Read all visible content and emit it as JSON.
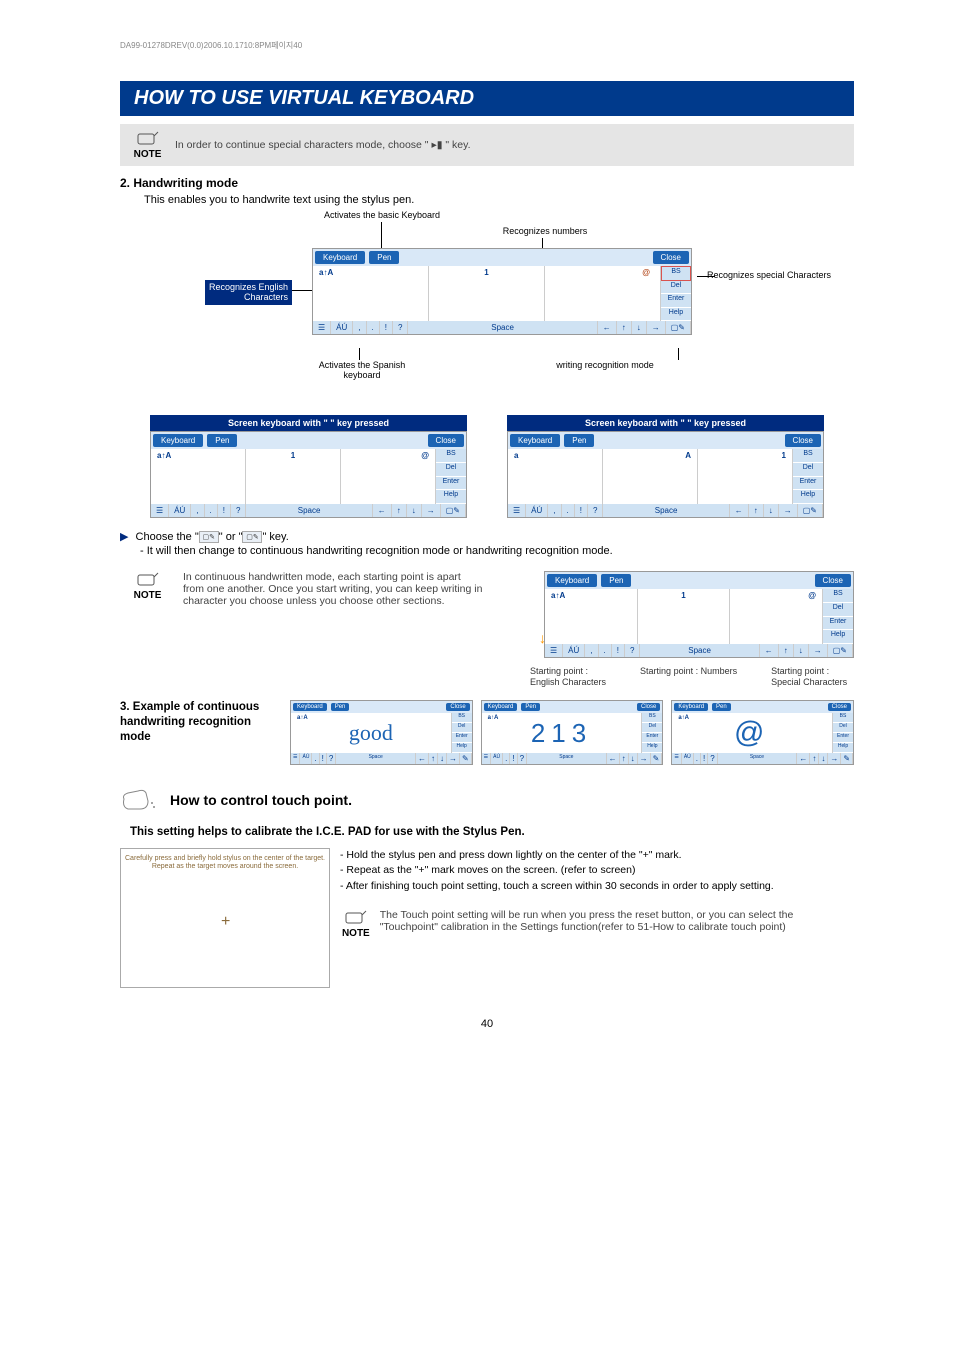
{
  "doc_header": "DA99-01278DREV(0.0)2006.10.1710:8PM페이지40",
  "title": "HOW TO USE VIRTUAL KEYBOARD",
  "note1_label": "NOTE",
  "note1_text": "In order to continue special characters mode, choose \" ▸▮ \" key.",
  "h_handwriting": "2. Handwriting mode",
  "handwriting_desc": "This enables you to handwrite text using the stylus pen.",
  "diagram1": {
    "lbl_basic": "Activates the basic Keyboard",
    "lbl_numbers": "Recognizes numbers",
    "lbl_special": "Recognizes special Characters",
    "lbl_english_1": "Recognizes English",
    "lbl_english_2": "Characters",
    "lbl_spanish_1": "Activates the Spanish",
    "lbl_spanish_2": "keyboard",
    "lbl_recmode": "writing recognition mode",
    "kbd_keyboard": "Keyboard",
    "kbd_pen": "Pen",
    "kbd_close": "Close",
    "kbd_space": "Space",
    "kbd_bs": "BS",
    "kbd_del": "Del",
    "kbd_enter": "Enter",
    "kbd_help": "Help",
    "panel_a": "a↑A",
    "panel_1": "1",
    "panel_at": "@",
    "bottom_au": "ÁÚ",
    "bottom_qm": "?"
  },
  "caption_left": "Screen keyboard with \"      \" key pressed",
  "caption_right": "Screen keyboard with \"      \" key pressed",
  "choose_line": "Choose the \"      \" or \"      \" key.",
  "choose_sub": "- It will then change to continuous handwriting recognition mode or handwriting recognition mode.",
  "note2_label": "NOTE",
  "note2_text": "In continuous handwritten mode, each starting point is apart from one another. Once you start writing, you can keep writing in character you choose unless you choose other sections.",
  "sp1": "Starting point :\nEnglish Characters",
  "sp2": "Starting point : Numbers",
  "sp3": "Starting point :\nSpecial Characters",
  "ex_label": "3. Example of continuous handwriting recognition mode",
  "ex_good": "good",
  "ex_213": "213",
  "ex_at": "@",
  "section_touch": "How to control touch point.",
  "sub_touch": "This setting helps to calibrate the I.C.E. PAD for use with the Stylus Pen.",
  "calib_instr_1": "Carefully press and briefly hold stylus on the center of the target.",
  "calib_instr_2": "Repeat as the target moves around the screen.",
  "dash1": "- Hold the stylus pen and press down lightly on the center of the \"+\" mark.",
  "dash2": "- Repeat as the \"+\" mark moves on the screen. (refer to screen)",
  "dash3": "- After finishing touch point setting, touch a screen within 30 seconds in order to apply setting.",
  "note3_label": "NOTE",
  "note3_text": "The Touch point setting will be run when you press the reset button, or you can select the \"Touchpoint\" calibration in the Settings function(refer to 51-How to calibrate touch point)",
  "page_num": "40"
}
